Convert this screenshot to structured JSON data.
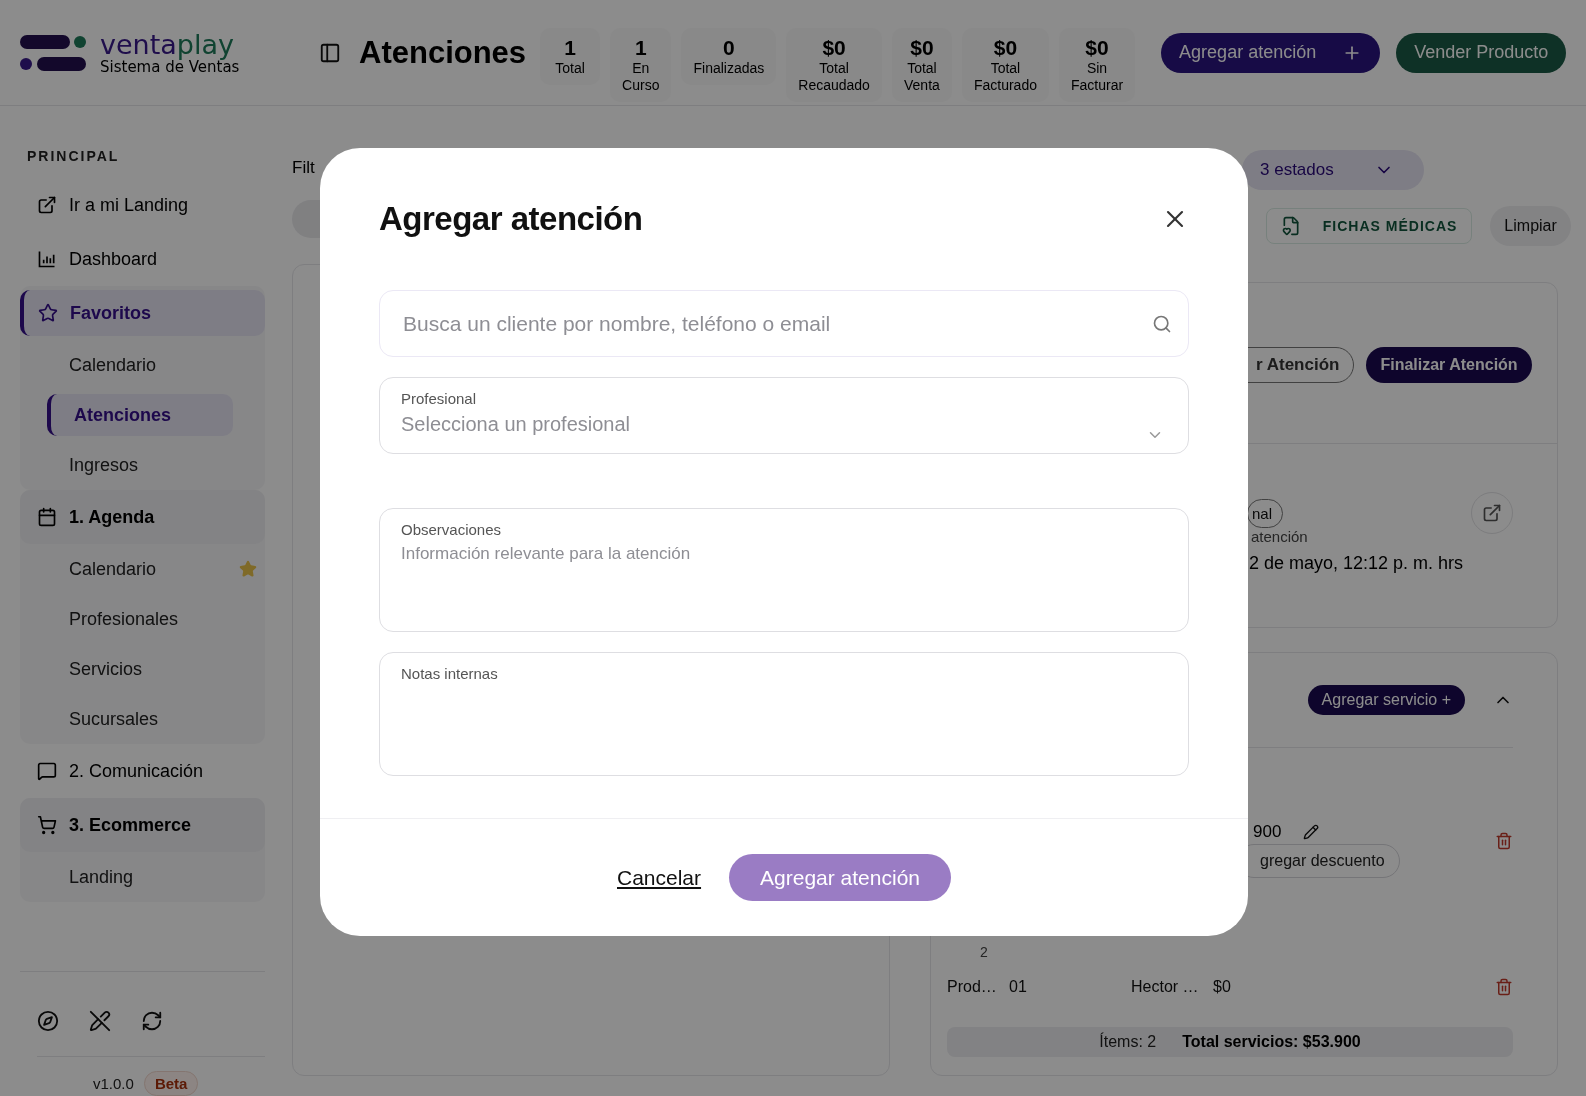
{
  "header": {
    "brand": {
      "part_1": "venta",
      "part_2": "play",
      "tagline": "Sistema de Ventas"
    },
    "title": "Atenciones",
    "stats": [
      {
        "value": "1",
        "label_lines": [
          "Total"
        ]
      },
      {
        "value": "1",
        "label_lines": [
          "En",
          "Curso"
        ]
      },
      {
        "value": "0",
        "label_lines": [
          "Finalizadas"
        ]
      },
      {
        "value": "$0",
        "label_lines": [
          "Total",
          "Recaudado"
        ]
      },
      {
        "value": "$0",
        "label_lines": [
          "Total",
          "Venta"
        ]
      },
      {
        "value": "$0",
        "label_lines": [
          "Total",
          "Facturado"
        ]
      },
      {
        "value": "$0",
        "label_lines": [
          "Sin",
          "Facturar"
        ]
      }
    ],
    "buttons": [
      {
        "label": "Agregar atención",
        "kind": "primary"
      },
      {
        "label": "Vender Producto",
        "kind": "success"
      }
    ]
  },
  "sidebar": {
    "section": "PRINCIPAL",
    "items": [
      {
        "label": "Ir a mi Landing",
        "kind": "external",
        "selected": false,
        "expanded": false
      },
      {
        "label": "Dashboard",
        "kind": "chart",
        "selected": false,
        "expanded": false
      },
      {
        "label": "Favoritos",
        "kind": "star",
        "selected": true,
        "expanded": true,
        "children": [
          {
            "label": "Calendario",
            "selected": false,
            "starred": false
          },
          {
            "label": "Atenciones",
            "selected": true,
            "starred": false
          },
          {
            "label": "Ingresos",
            "selected": false,
            "starred": false
          }
        ]
      },
      {
        "label": "1. Agenda",
        "kind": "calendar",
        "selected": false,
        "expanded": true,
        "children": [
          {
            "label": "Calendario",
            "selected": false,
            "starred": true
          },
          {
            "label": "Profesionales",
            "selected": false,
            "starred": false
          },
          {
            "label": "Servicios",
            "selected": false,
            "starred": false
          },
          {
            "label": "Sucursales",
            "selected": false,
            "starred": false
          }
        ]
      },
      {
        "label": "2. Comunicación",
        "kind": "message",
        "selected": false,
        "expanded": false
      },
      {
        "label": "3. Ecommerce",
        "kind": "cart",
        "selected": false,
        "expanded": true,
        "children": [
          {
            "label": "Landing",
            "selected": false,
            "starred": false
          }
        ]
      }
    ],
    "version": "v1.0.0",
    "badge": "Beta"
  },
  "main": {
    "filter_label": "Filt",
    "status_filter": "3 estados",
    "records_button": "FICHAS MÉDICAS",
    "clear_button": "Limpiar",
    "attention_card": {
      "secondary_button": "r Atención",
      "finish_button": "Finalizar Atención",
      "chip": "nal",
      "date_label": "atención",
      "date": "2 de mayo, 12:12 p. m. hrs"
    },
    "services_card": {
      "add_button": "Agregar servicio +",
      "price": "900",
      "discount_button": "gregar descuento",
      "row_number": "2",
      "row": [
        "Prod…",
        "01",
        "Hector …",
        "$0"
      ],
      "items_count": "Ítems: 2",
      "total": "Total servicios: $53.900"
    }
  },
  "modal": {
    "title": "Agregar atención",
    "search": {
      "placeholder": "Busca un cliente por nombre, teléfono o email"
    },
    "professional": {
      "label": "Profesional",
      "placeholder": "Selecciona un profesional"
    },
    "observations": {
      "label": "Observaciones",
      "placeholder": "Información relevante para la atención"
    },
    "notes": {
      "label": "Notas internas"
    },
    "cancel": "Cancelar",
    "submit": {
      "label": "Agregar atención",
      "disabled": true
    }
  }
}
